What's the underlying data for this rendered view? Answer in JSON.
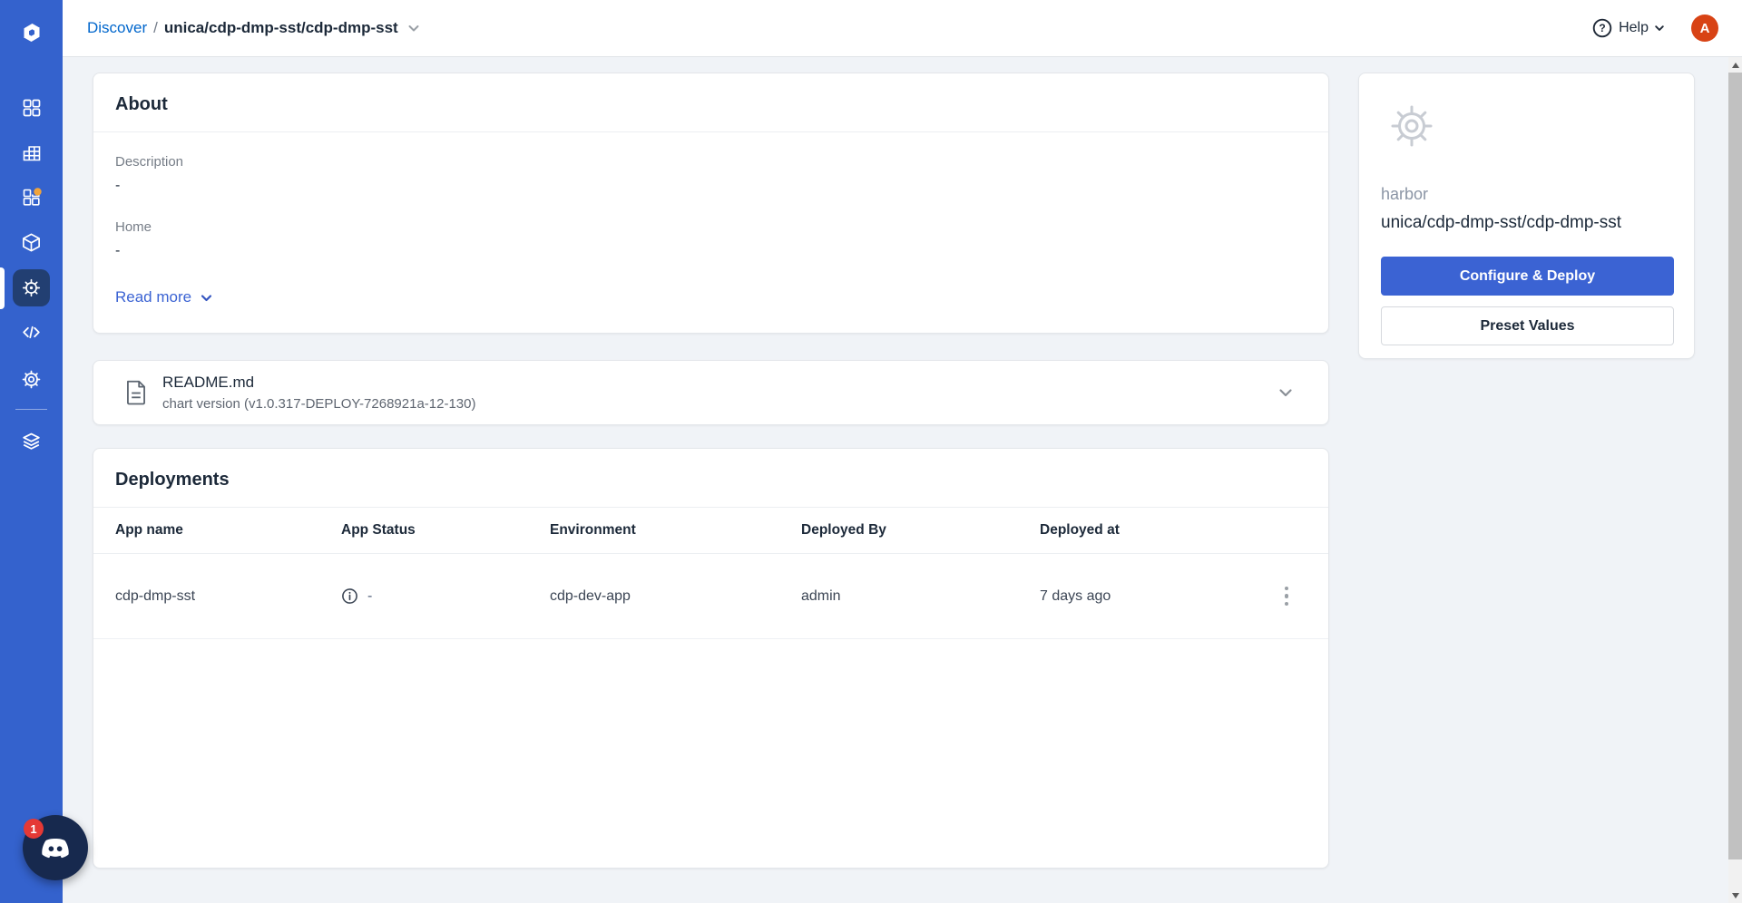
{
  "header": {
    "breadcrumb": {
      "section": "Discover",
      "separator": "/",
      "current": "unica/cdp-dmp-sst/cdp-dmp-sst"
    },
    "help": {
      "label": "Help",
      "glyph": "?"
    },
    "avatar": {
      "initial": "A"
    }
  },
  "sidebar": {
    "icons": [
      {
        "name": "devtron-logo"
      },
      {
        "name": "applications-grid-icon"
      },
      {
        "name": "app-group-table-icon"
      },
      {
        "name": "jobs-icon",
        "notification_dot": true
      },
      {
        "name": "chart-store-cube-icon"
      },
      {
        "name": "helm-wheel-icon",
        "active": true
      },
      {
        "name": "code-icon"
      },
      {
        "name": "settings-gear-icon"
      },
      {
        "name": "resource-stack-icon"
      },
      {
        "name": "discord-icon"
      }
    ],
    "discord_badge_count": "1"
  },
  "about": {
    "title": "About",
    "fields": [
      {
        "label": "Description",
        "value": "-"
      },
      {
        "label": "Home",
        "value": "-"
      }
    ],
    "read_more_label": "Read more"
  },
  "readme": {
    "filename": "README.md",
    "chart_version_line": "chart version (v1.0.317-DEPLOY-7268921a-12-130)"
  },
  "deployments": {
    "title": "Deployments",
    "columns": [
      "App name",
      "App Status",
      "Environment",
      "Deployed By",
      "Deployed at"
    ],
    "rows": [
      {
        "app_name": "cdp-dmp-sst",
        "app_status": "-",
        "environment": "cdp-dev-app",
        "deployed_by": "admin",
        "deployed_at": "7 days ago"
      }
    ]
  },
  "chart_panel": {
    "repo": "harbor",
    "chart_name": "unica/cdp-dmp-sst/cdp-dmp-sst",
    "configure_deploy_label": "Configure & Deploy",
    "preset_values_label": "Preset Values"
  },
  "colors": {
    "sidebar_blue": "#3462cd",
    "active_item_bg": "#223f72",
    "accent_blue": "#3b63d3",
    "breadcrumb_link_blue": "#0066cc",
    "avatar_orange": "#d84315",
    "discord_navy": "#17294e",
    "badge_red": "#e53935",
    "notification_dot_orange": "#f0a43c",
    "page_bg": "#f0f3f7"
  }
}
